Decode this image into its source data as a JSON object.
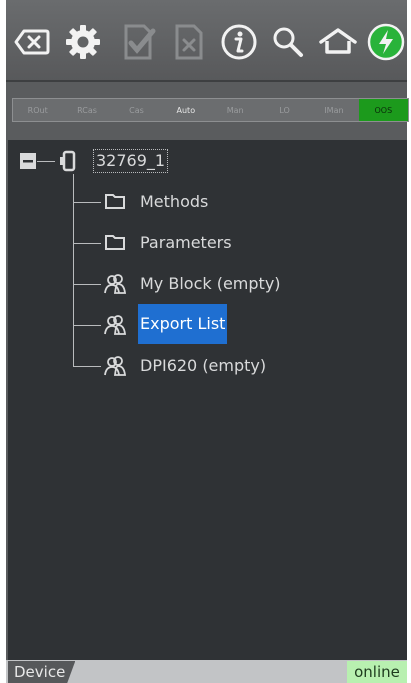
{
  "toolbar": {
    "icons": [
      "backspace-icon",
      "gear-icon",
      "check-document-icon",
      "cancel-document-icon",
      "info-icon",
      "search-icon",
      "home-icon",
      "power-icon"
    ]
  },
  "modes": [
    {
      "label": "ROut"
    },
    {
      "label": "RCas"
    },
    {
      "label": "Cas"
    },
    {
      "label": "Auto"
    },
    {
      "label": "Man"
    },
    {
      "label": "LO"
    },
    {
      "label": "IMan"
    },
    {
      "label": "OOS"
    }
  ],
  "tree": {
    "root": {
      "label": "32769_1"
    },
    "children": [
      {
        "label": "Methods",
        "icon": "folder-icon"
      },
      {
        "label": "Parameters",
        "icon": "folder-icon"
      },
      {
        "label": "My Block (empty)",
        "icon": "users-icon"
      },
      {
        "label": "Export List",
        "icon": "users-icon",
        "selected": true
      },
      {
        "label": "DPI620 (empty)",
        "icon": "users-icon"
      }
    ]
  },
  "status": {
    "tab_label": "Device",
    "state": "online"
  },
  "colors": {
    "selection": "#1f6fd1",
    "oos": "#1c9a1c",
    "online_bg": "#b8f0b0",
    "panel_bg": "#2f3235"
  }
}
